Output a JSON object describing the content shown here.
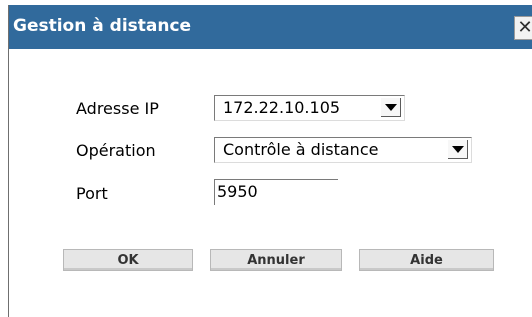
{
  "dialog": {
    "title": "Gestion à distance",
    "close_icon": "close-icon",
    "close_glyph": "✕"
  },
  "form": {
    "ip_label": "Adresse IP",
    "ip_value": "172.22.10.105",
    "operation_label": "Opération",
    "operation_value": "Contrôle à distance",
    "port_label": "Port",
    "port_value": "5950"
  },
  "buttons": {
    "ok": "OK",
    "cancel": "Annuler",
    "help": "Aide"
  },
  "colors": {
    "titlebar": "#316a9c",
    "title_text": "#ffffff"
  }
}
